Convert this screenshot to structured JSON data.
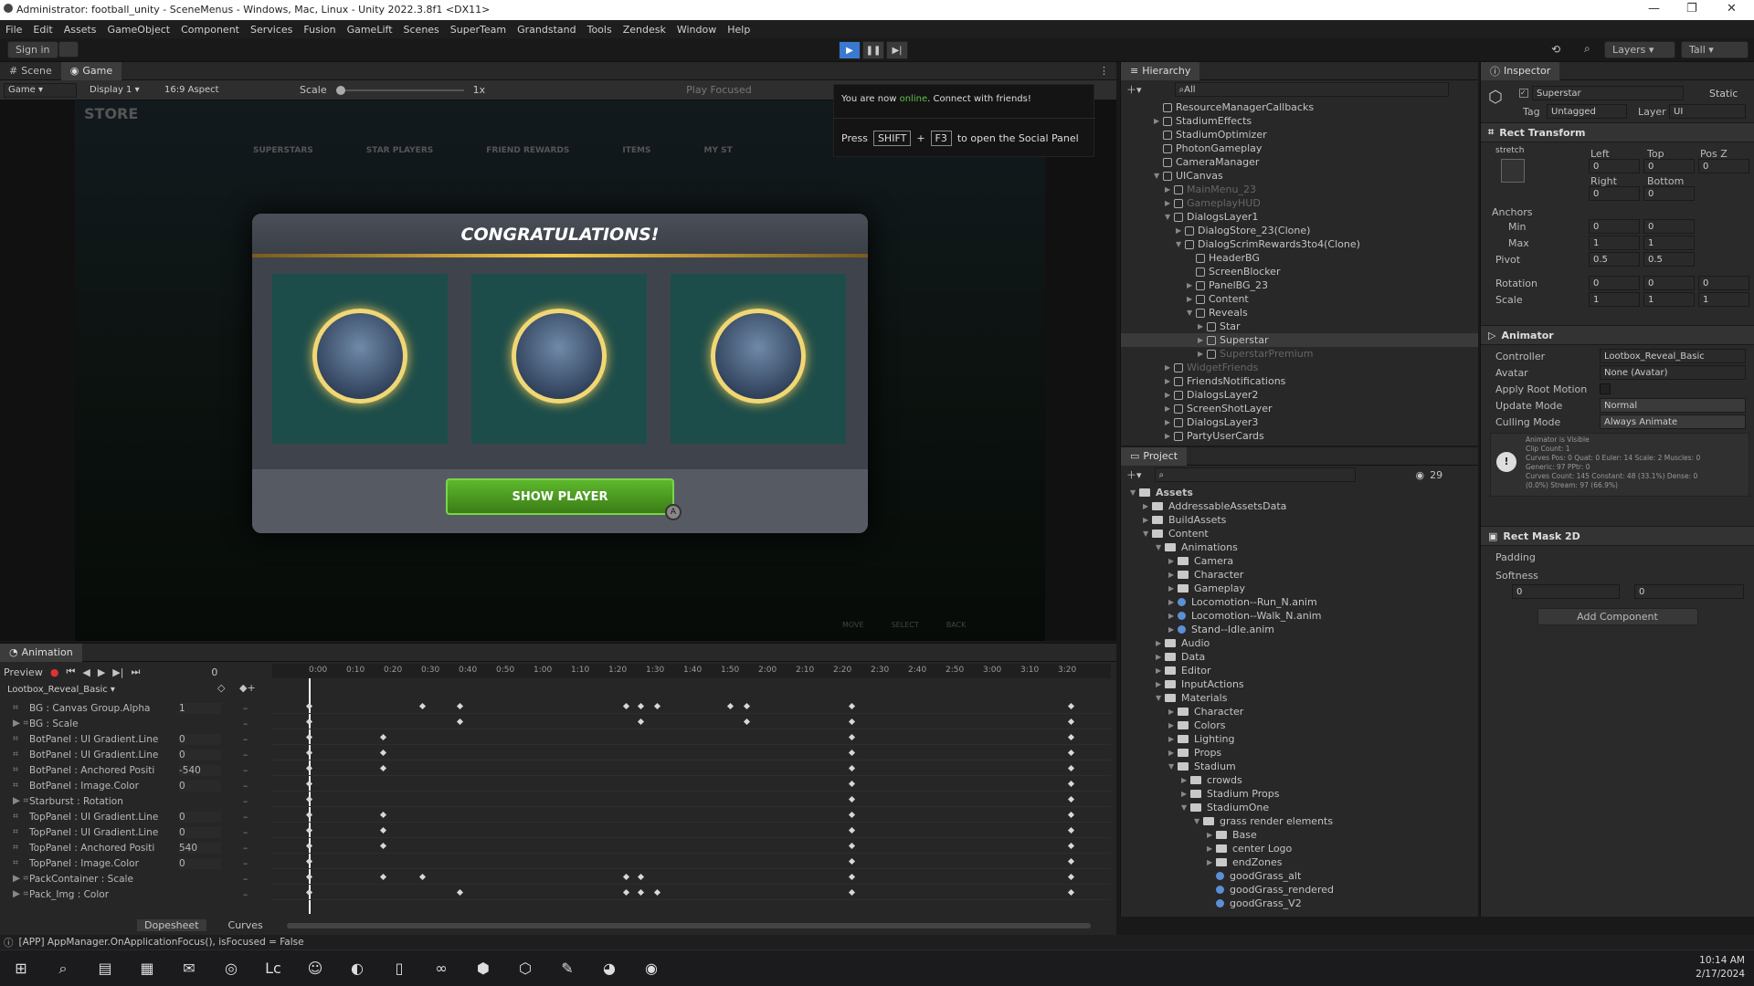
{
  "window": {
    "title": "Administrator: football_unity - SceneMenus - Windows, Mac, Linux - Unity 2022.3.8f1 <DX11>"
  },
  "menu": [
    "File",
    "Edit",
    "Assets",
    "GameObject",
    "Component",
    "Services",
    "Fusion",
    "GameLift",
    "Scenes",
    "SuperTeam",
    "Grandstand",
    "Tools",
    "Zendesk",
    "Window",
    "Help"
  ],
  "toolbar": {
    "sign_in": "Sign in",
    "layers": "Layers",
    "layout": "Tall"
  },
  "scene_tabs": {
    "scene": "Scene",
    "game": "Game"
  },
  "game_bar": {
    "mode": "Game",
    "display": "Display 1",
    "aspect": "16:9 Aspect",
    "scale_label": "Scale",
    "scale_value": "1x",
    "play_focused": "Play Focused"
  },
  "game": {
    "store_title": "STORE",
    "nav": [
      "SUPERSTARS",
      "STAR PLAYERS",
      "FRIEND REWARDS",
      "ITEMS",
      "MY ST"
    ],
    "dialog_title": "CONGRATULATIONS!",
    "show_button": "SHOW PLAYER",
    "bottom_hints": [
      "MOVE",
      "SELECT",
      "BACK"
    ]
  },
  "notification": {
    "line1_pre": "You are now ",
    "line1_status": "online",
    "line1_post": ". Connect with friends!",
    "press": "Press",
    "key1": "SHIFT",
    "plus": "+",
    "key2": "F3",
    "suffix": "to open the Social Panel"
  },
  "hierarchy": {
    "title": "Hierarchy",
    "search": "All",
    "items": [
      {
        "name": "ResourceManagerCallbacks",
        "indent": 1,
        "arrow": ""
      },
      {
        "name": "StadiumEffects",
        "indent": 1,
        "arrow": "▶"
      },
      {
        "name": "StadiumOptimizer",
        "indent": 1,
        "arrow": ""
      },
      {
        "name": "PhotonGameplay",
        "indent": 1,
        "arrow": ""
      },
      {
        "name": "CameraManager",
        "indent": 1,
        "arrow": ""
      },
      {
        "name": "UICanvas",
        "indent": 1,
        "arrow": "▼"
      },
      {
        "name": "MainMenu_23",
        "indent": 2,
        "arrow": "▶",
        "dim": true
      },
      {
        "name": "GameplayHUD",
        "indent": 2,
        "arrow": "▶",
        "dim": true
      },
      {
        "name": "DialogsLayer1",
        "indent": 2,
        "arrow": "▼"
      },
      {
        "name": "DialogStore_23(Clone)",
        "indent": 3,
        "arrow": "▶"
      },
      {
        "name": "DialogScrimRewards3to4(Clone)",
        "indent": 3,
        "arrow": "▼"
      },
      {
        "name": "HeaderBG",
        "indent": 4,
        "arrow": ""
      },
      {
        "name": "ScreenBlocker",
        "indent": 4,
        "arrow": ""
      },
      {
        "name": "PanelBG_23",
        "indent": 4,
        "arrow": "▶"
      },
      {
        "name": "Content",
        "indent": 4,
        "arrow": "▶"
      },
      {
        "name": "Reveals",
        "indent": 4,
        "arrow": "▼"
      },
      {
        "name": "Star",
        "indent": 5,
        "arrow": "▶"
      },
      {
        "name": "Superstar",
        "indent": 5,
        "arrow": "▶",
        "selected": true
      },
      {
        "name": "SuperstarPremium",
        "indent": 5,
        "arrow": "▶",
        "dim": true
      },
      {
        "name": "WidgetFriends",
        "indent": 2,
        "arrow": "▶",
        "dim": true
      },
      {
        "name": "FriendsNotifications",
        "indent": 2,
        "arrow": "▶"
      },
      {
        "name": "DialogsLayer2",
        "indent": 2,
        "arrow": "▶"
      },
      {
        "name": "ScreenShotLayer",
        "indent": 2,
        "arrow": "▶"
      },
      {
        "name": "DialogsLayer3",
        "indent": 2,
        "arrow": "▶"
      },
      {
        "name": "PartyUserCards",
        "indent": 2,
        "arrow": "▶"
      }
    ]
  },
  "project": {
    "title": "Project",
    "count": "29",
    "items": [
      {
        "name": "Assets",
        "indent": 0,
        "arrow": "▼",
        "bold": true
      },
      {
        "name": "AddressableAssetsData",
        "indent": 1,
        "arrow": "▶"
      },
      {
        "name": "BuildAssets",
        "indent": 1,
        "arrow": "▶"
      },
      {
        "name": "Content",
        "indent": 1,
        "arrow": "▼"
      },
      {
        "name": "Animations",
        "indent": 2,
        "arrow": "▼"
      },
      {
        "name": "Camera",
        "indent": 3,
        "arrow": "▶"
      },
      {
        "name": "Character",
        "indent": 3,
        "arrow": "▶"
      },
      {
        "name": "Gameplay",
        "indent": 3,
        "arrow": "▶"
      },
      {
        "name": "Locomotion--Run_N.anim",
        "indent": 3,
        "arrow": "▶",
        "file": true
      },
      {
        "name": "Locomotion--Walk_N.anim",
        "indent": 3,
        "arrow": "▶",
        "file": true
      },
      {
        "name": "Stand--Idle.anim",
        "indent": 3,
        "arrow": "▶",
        "file": true
      },
      {
        "name": "Audio",
        "indent": 2,
        "arrow": "▶"
      },
      {
        "name": "Data",
        "indent": 2,
        "arrow": "▶"
      },
      {
        "name": "Editor",
        "indent": 2,
        "arrow": "▶"
      },
      {
        "name": "InputActions",
        "indent": 2,
        "arrow": "▶"
      },
      {
        "name": "Materials",
        "indent": 2,
        "arrow": "▼"
      },
      {
        "name": "Character",
        "indent": 3,
        "arrow": "▶"
      },
      {
        "name": "Colors",
        "indent": 3,
        "arrow": "▶"
      },
      {
        "name": "Lighting",
        "indent": 3,
        "arrow": "▶"
      },
      {
        "name": "Props",
        "indent": 3,
        "arrow": "▶"
      },
      {
        "name": "Stadium",
        "indent": 3,
        "arrow": "▼"
      },
      {
        "name": "crowds",
        "indent": 4,
        "arrow": "▶"
      },
      {
        "name": "Stadium Props",
        "indent": 4,
        "arrow": "▶"
      },
      {
        "name": "StadiumOne",
        "indent": 4,
        "arrow": "▼"
      },
      {
        "name": "grass render elements",
        "indent": 5,
        "arrow": "▼"
      },
      {
        "name": "Base",
        "indent": 6,
        "arrow": "▶"
      },
      {
        "name": "center Logo",
        "indent": 6,
        "arrow": "▶"
      },
      {
        "name": "endZones",
        "indent": 6,
        "arrow": "▶"
      },
      {
        "name": "goodGrass_alt",
        "indent": 6,
        "arrow": "",
        "file": true
      },
      {
        "name": "goodGrass_rendered",
        "indent": 6,
        "arrow": "",
        "file": true
      },
      {
        "name": "goodGrass_V2",
        "indent": 6,
        "arrow": "",
        "file": true
      }
    ]
  },
  "inspector": {
    "title": "Inspector",
    "object_name": "Superstar",
    "static": "Static",
    "tag_label": "Tag",
    "tag_value": "Untagged",
    "layer_label": "Layer",
    "layer_value": "UI",
    "rect": {
      "title": "Rect Transform",
      "stretch": "stretch",
      "left": "Left",
      "top": "Top",
      "posz": "Pos Z",
      "left_v": "0",
      "top_v": "0",
      "posz_v": "0",
      "right": "Right",
      "bottom": "Bottom",
      "right_v": "0",
      "bottom_v": "0",
      "anchors": "Anchors",
      "min": "Min",
      "max": "Max",
      "pivot": "Pivot",
      "min_x": "0",
      "min_y": "0",
      "max_x": "1",
      "max_y": "1",
      "pivot_x": "0.5",
      "pivot_y": "0.5",
      "rotation": "Rotation",
      "rot_x": "0",
      "rot_y": "0",
      "rot_z": "0",
      "scale": "Scale",
      "sc_x": "1",
      "sc_y": "1",
      "sc_z": "1"
    },
    "animator": {
      "title": "Animator",
      "controller_label": "Controller",
      "controller": "Lootbox_Reveal_Basic",
      "avatar_label": "Avatar",
      "avatar": "None (Avatar)",
      "root_motion": "Apply Root Motion",
      "update_label": "Update Mode",
      "update": "Normal",
      "culling_label": "Culling Mode",
      "culling": "Always Animate",
      "info": [
        "Animator is Visible",
        "Clip Count: 1",
        "Curves Pos: 0 Quat: 0 Euler: 14 Scale: 2 Muscles: 0",
        "Generic: 97 PPtr: 0",
        "Curves Count: 145 Constant: 48 (33.1%) Dense: 0",
        "(0.0%) Stream: 97 (66.9%)"
      ]
    },
    "mask": {
      "title": "Rect Mask 2D",
      "padding": "Padding",
      "softness": "Softness",
      "x": "0",
      "y": "0"
    },
    "add_component": "Add Component"
  },
  "animation": {
    "title": "Animation",
    "preview": "Preview",
    "frame": "0",
    "clip": "Lootbox_Reveal_Basic",
    "ticks": [
      "0:00",
      "0:10",
      "0:20",
      "0:30",
      "0:40",
      "0:50",
      "1:00",
      "1:10",
      "1:20",
      "1:30",
      "1:40",
      "1:50",
      "2:00",
      "2:10",
      "2:20",
      "2:30",
      "2:40",
      "2:50",
      "3:00",
      "3:10",
      "3:20"
    ],
    "props": [
      {
        "name": "BG : Canvas Group.Alpha",
        "value": "1",
        "expand": false
      },
      {
        "name": "BG : Scale",
        "value": "",
        "expand": true
      },
      {
        "name": "BotPanel : UI Gradient.Line",
        "value": "0",
        "expand": false
      },
      {
        "name": "BotPanel : UI Gradient.Line",
        "value": "0",
        "expand": false
      },
      {
        "name": "BotPanel : Anchored Positi",
        "value": "-540",
        "expand": false
      },
      {
        "name": "BotPanel : Image.Color",
        "value": "0",
        "expand": false
      },
      {
        "name": "Starburst : Rotation",
        "value": "",
        "expand": true
      },
      {
        "name": "TopPanel : UI Gradient.Line",
        "value": "0",
        "expand": false
      },
      {
        "name": "TopPanel : UI Gradient.Line",
        "value": "0",
        "expand": false
      },
      {
        "name": "TopPanel : Anchored Positi",
        "value": "540",
        "expand": false
      },
      {
        "name": "TopPanel : Image.Color",
        "value": "0",
        "expand": false
      },
      {
        "name": "PackContainer : Scale",
        "value": "",
        "expand": true
      },
      {
        "name": "Pack_Img : Color",
        "value": "",
        "expand": true
      }
    ],
    "dopesheet": "Dopesheet",
    "curves": "Curves"
  },
  "status": {
    "message": "[APP] AppManager.OnApplicationFocus(), isFocused = False"
  },
  "clock": {
    "time": "10:14 AM",
    "date": "2/17/2024"
  },
  "taskbar_icons": [
    "windows-icon",
    "search-icon",
    "taskview-icon",
    "store-icon",
    "mail-icon",
    "chrome-icon",
    "lc-icon",
    "discord-icon",
    "edge-icon",
    "file-icon",
    "vs-icon",
    "unity-hub-icon",
    "unity-icon",
    "pencil-icon",
    "panda-icon",
    "chrome2-icon"
  ],
  "colors": {
    "accent": "#3a79d0",
    "green_btn": "#4b9a1e",
    "gold": "#e6c25a",
    "teal": "#1d4d4a"
  }
}
